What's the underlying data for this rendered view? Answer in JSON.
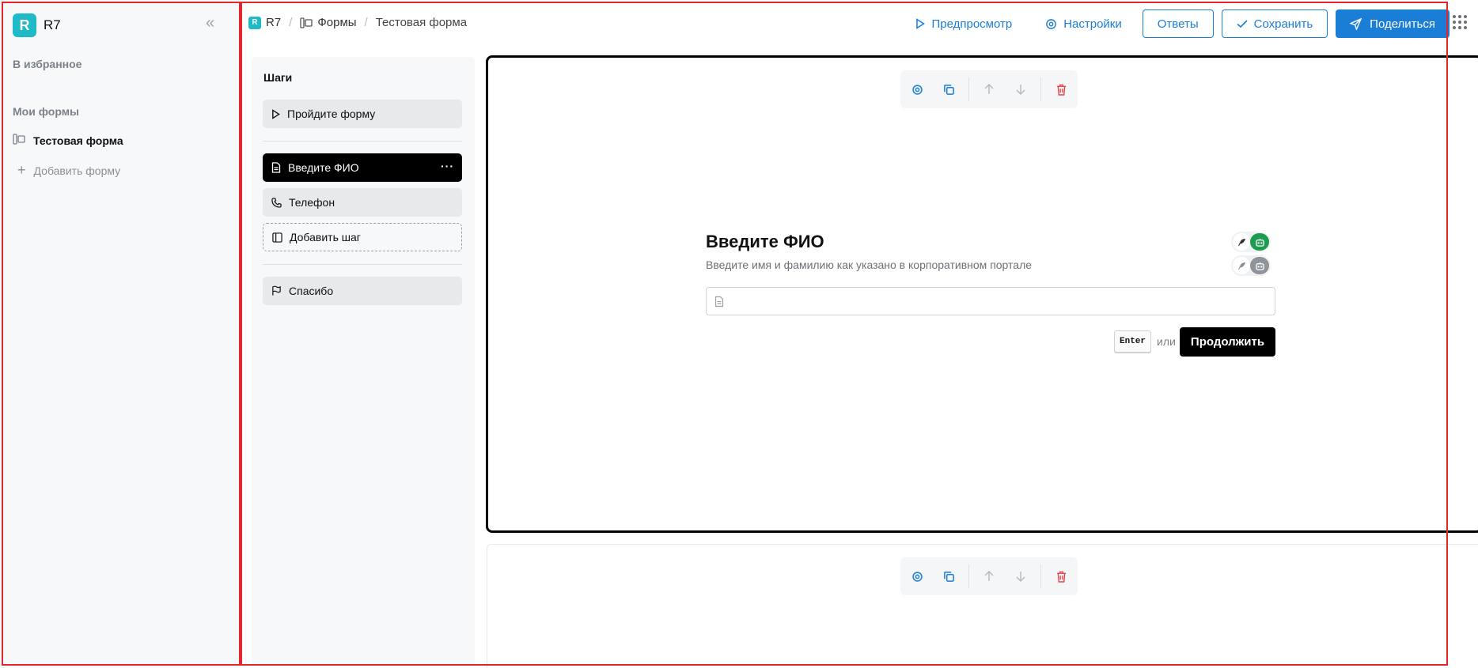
{
  "sidebar": {
    "brand_letter": "R",
    "brand_name": "R7",
    "favorites_label": "В избранное",
    "my_forms_label": "Мои формы",
    "forms": [
      {
        "label": "Тестовая форма",
        "active": true
      }
    ],
    "add_form_label": "Добавить форму"
  },
  "breadcrumbs": {
    "logo_letter": "R",
    "root": "R7",
    "forms": "Формы",
    "current": "Тестовая форма"
  },
  "toolbar": {
    "preview_label": "Предпросмотр",
    "settings_label": "Настройки",
    "answers_label": "Ответы",
    "save_label": "Сохранить",
    "share_label": "Поделиться"
  },
  "steps": {
    "title": "Шаги",
    "start_label": "Пройдите форму",
    "items": [
      {
        "label": "Введите ФИО",
        "icon": "document-icon",
        "active": true
      },
      {
        "label": "Телефон",
        "icon": "phone-icon",
        "active": false
      }
    ],
    "add_step_label": "Добавить шаг",
    "end_label": "Спасибо"
  },
  "question": {
    "title": "Введите ФИО",
    "description": "Введите имя и фамилию как указано в корпоративном портале",
    "input_value": "",
    "input_placeholder": "",
    "key_hint": "Enter",
    "or_text": "или",
    "continue_label": "Продолжить"
  },
  "colors": {
    "accent": "#1b7ed6",
    "brand": "#1fb9c8",
    "toggle_green": "#1e9b4f",
    "danger": "#e5484d"
  }
}
